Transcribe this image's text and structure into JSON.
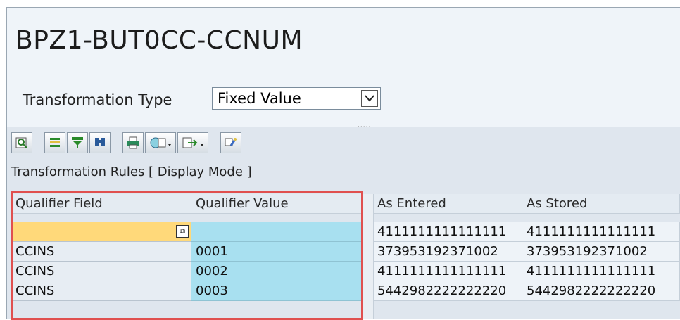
{
  "title": "BPZ1-BUT0CC-CCNUM",
  "transformation_type": {
    "label": "Transformation Type",
    "value": "Fixed Value"
  },
  "toolbar": {
    "icons": [
      "details-icon",
      "align-icon",
      "filter-icon",
      "find-icon",
      "print-icon",
      "view-icon",
      "export-icon",
      "layout-icon"
    ]
  },
  "grid": {
    "caption": "Transformation Rules [ Display Mode ]",
    "headers": {
      "qualifier_field": "Qualifier Field",
      "qualifier_value": "Qualifier Value",
      "as_entered": "As Entered",
      "as_stored": "As Stored"
    },
    "rows": [
      {
        "qualifier_field": "",
        "qualifier_value": "",
        "as_entered": "4111111111111111",
        "as_stored": "4111111111111111"
      },
      {
        "qualifier_field": "CCINS",
        "qualifier_value": "0001",
        "as_entered": "373953192371002",
        "as_stored": "373953192371002"
      },
      {
        "qualifier_field": "CCINS",
        "qualifier_value": "0002",
        "as_entered": "4111111111111111",
        "as_stored": "4111111111111111"
      },
      {
        "qualifier_field": "CCINS",
        "qualifier_value": "0003",
        "as_entered": "5442982222222220",
        "as_stored": "5442982222222220"
      }
    ]
  },
  "colors": {
    "highlight": "#e0504f",
    "qualifier_value_bg": "#a8e0f0",
    "focus_bg": "#ffd97a"
  }
}
